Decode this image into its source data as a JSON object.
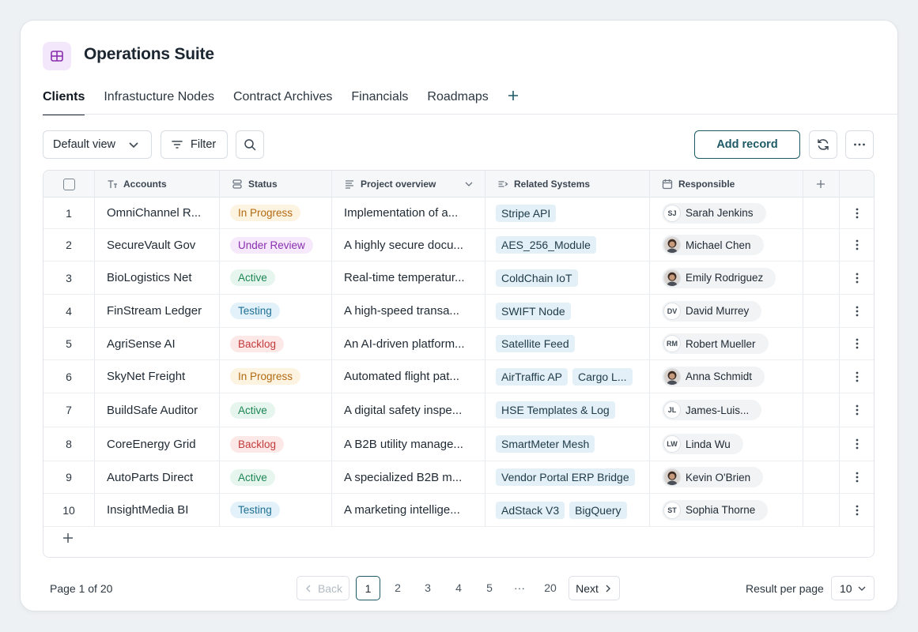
{
  "app": {
    "title": "Operations Suite"
  },
  "tabs": [
    {
      "label": "Clients",
      "active": true
    },
    {
      "label": "Infrastucture Nodes"
    },
    {
      "label": "Contract Archives"
    },
    {
      "label": "Financials"
    },
    {
      "label": "Roadmaps"
    }
  ],
  "toolbar": {
    "view_label": "Default view",
    "filter_label": "Filter",
    "add_label": "Add record"
  },
  "columns": {
    "accounts": "Accounts",
    "status": "Status",
    "project": "Project overview",
    "related": "Related Systems",
    "responsible": "Responsible"
  },
  "status_colors": {
    "In Progress": {
      "bg": "#fdf3e1",
      "fg": "#b36a12"
    },
    "Under Review": {
      "bg": "#f5e9fb",
      "fg": "#8a2fb0"
    },
    "Active": {
      "bg": "#e6f6ee",
      "fg": "#1c8553"
    },
    "Testing": {
      "bg": "#e3f2fa",
      "fg": "#1f6f93"
    },
    "Backlog": {
      "bg": "#fde8e8",
      "fg": "#c23b3b"
    }
  },
  "rows": [
    {
      "num": "1",
      "account": "OmniChannel R...",
      "status": "In Progress",
      "project": "Implementation of a...",
      "systems": [
        "Stripe API"
      ],
      "person": {
        "name": "Sarah Jenkins",
        "initials": "SJ",
        "photo": false
      }
    },
    {
      "num": "2",
      "account": "SecureVault Gov",
      "status": "Under Review",
      "project": "A highly secure docu...",
      "systems": [
        "AES_256_Module"
      ],
      "person": {
        "name": "Michael Chen",
        "initials": "",
        "photo": true
      }
    },
    {
      "num": "3",
      "account": "BioLogistics Net",
      "status": "Active",
      "project": "Real-time temperatur...",
      "systems": [
        "ColdChain IoT"
      ],
      "person": {
        "name": "Emily Rodriguez",
        "initials": "",
        "photo": true
      }
    },
    {
      "num": "4",
      "account": "FinStream Ledger",
      "status": "Testing",
      "project": "A high-speed transa...",
      "systems": [
        "SWIFT Node"
      ],
      "person": {
        "name": "David Murrey",
        "initials": "DV",
        "photo": false
      }
    },
    {
      "num": "5",
      "account": "AgriSense AI",
      "status": "Backlog",
      "project": "An AI-driven platform...",
      "systems": [
        "Satellite Feed"
      ],
      "person": {
        "name": "Robert Mueller",
        "initials": "RM",
        "photo": false
      }
    },
    {
      "num": "6",
      "account": "SkyNet Freight",
      "status": "In Progress",
      "project": "Automated flight pat...",
      "systems": [
        "AirTraffic AP",
        "Cargo L..."
      ],
      "person": {
        "name": "Anna Schmidt",
        "initials": "",
        "photo": true
      }
    },
    {
      "num": "7",
      "account": "BuildSafe Auditor",
      "status": "Active",
      "project": "A digital safety inspe...",
      "systems": [
        "HSE Templates & Log"
      ],
      "person": {
        "name": "James-Luis...",
        "initials": "JL",
        "photo": false
      }
    },
    {
      "num": "8",
      "account": "CoreEnergy Grid",
      "status": "Backlog",
      "project": "A B2B utility manage...",
      "systems": [
        "SmartMeter Mesh"
      ],
      "person": {
        "name": "Linda Wu",
        "initials": "LW",
        "photo": false
      }
    },
    {
      "num": "9",
      "account": "AutoParts Direct",
      "status": "Active",
      "project": "A specialized B2B m...",
      "systems": [
        "Vendor Portal ERP Bridge"
      ],
      "person": {
        "name": "Kevin O'Brien",
        "initials": "",
        "photo": true
      }
    },
    {
      "num": "10",
      "account": "InsightMedia BI",
      "status": "Testing",
      "project": "A marketing intellige...",
      "systems": [
        "AdStack V3",
        "BigQuery"
      ],
      "person": {
        "name": "Sophia Thorne",
        "initials": "ST",
        "photo": false
      }
    }
  ],
  "pagination": {
    "info": "Page 1 of 20",
    "back_label": "Back",
    "next_label": "Next",
    "current": "1",
    "pages": [
      "2",
      "3",
      "4",
      "5"
    ],
    "ellipsis": "···",
    "last": "20",
    "rpp_label": "Result per page",
    "rpp_value": "10"
  },
  "icons": {
    "app": "table-grid-icon",
    "tab_add": "plus-icon",
    "view": "chevron-down-icon",
    "filter": "filter-lines-icon",
    "search": "search-icon",
    "refresh": "refresh-icon",
    "more": "ellipsis-horizontal-icon",
    "accounts": "text-type-icon",
    "status": "stack-icon",
    "project": "align-left-icon",
    "related": "link-list-icon",
    "responsible": "calendar-icon",
    "row_menu": "vertical-dots-icon"
  },
  "accent": "#1d5a66"
}
